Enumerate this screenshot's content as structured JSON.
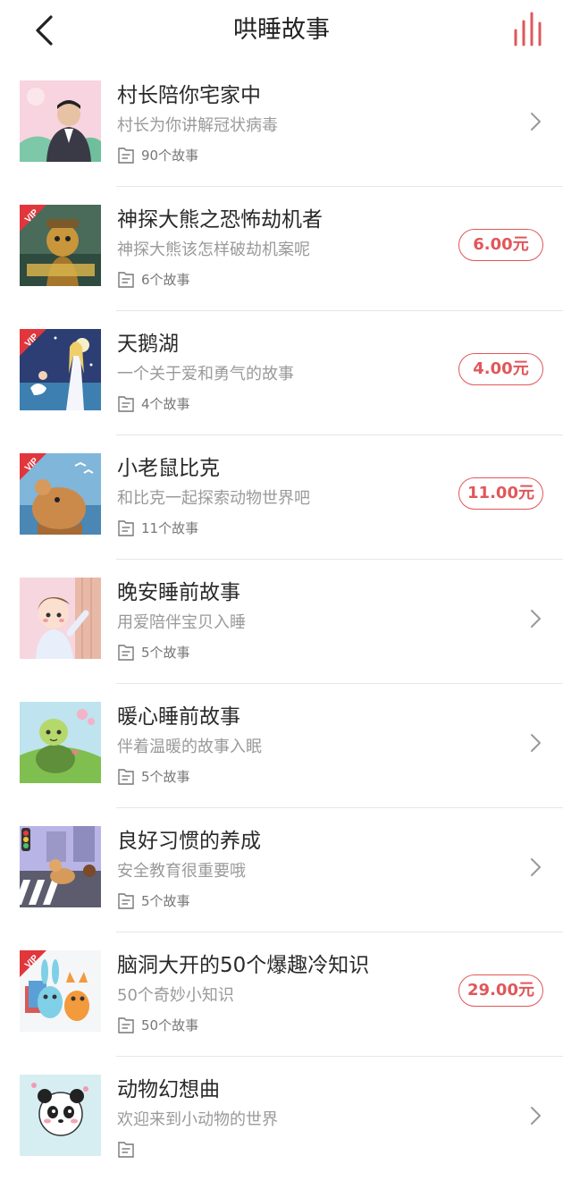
{
  "header": {
    "title": "哄睡故事",
    "back_icon": "chevron-left-icon",
    "player_icon": "audio-bars-icon",
    "accent_color": "#e0575a"
  },
  "items": [
    {
      "title": "村长陪你宅家中",
      "subtitle": "村长为你讲解冠状病毒",
      "count": "90个故事",
      "price": "",
      "vip": false
    },
    {
      "title": "神探大熊之恐怖劫机者",
      "subtitle": "神探大熊该怎样破劫机案呢",
      "count": "6个故事",
      "price": "6.00元",
      "vip": true
    },
    {
      "title": "天鹅湖",
      "subtitle": "一个关于爱和勇气的故事",
      "count": "4个故事",
      "price": "4.00元",
      "vip": true
    },
    {
      "title": "小老鼠比克",
      "subtitle": "和比克一起探索动物世界吧",
      "count": "11个故事",
      "price": "11.00元",
      "vip": true
    },
    {
      "title": "晚安睡前故事",
      "subtitle": "用爱陪伴宝贝入睡",
      "count": "5个故事",
      "price": "",
      "vip": false
    },
    {
      "title": "暖心睡前故事",
      "subtitle": "伴着温暖的故事入眠",
      "count": "5个故事",
      "price": "",
      "vip": false
    },
    {
      "title": "良好习惯的养成",
      "subtitle": "安全教育很重要哦",
      "count": "5个故事",
      "price": "",
      "vip": false
    },
    {
      "title": "脑洞大开的50个爆趣冷知识",
      "subtitle": "50个奇妙小知识",
      "count": "50个故事",
      "price": "29.00元",
      "vip": true
    },
    {
      "title": "动物幻想曲",
      "subtitle": "欢迎来到小动物的世界",
      "count": "",
      "price": "",
      "vip": false
    }
  ]
}
